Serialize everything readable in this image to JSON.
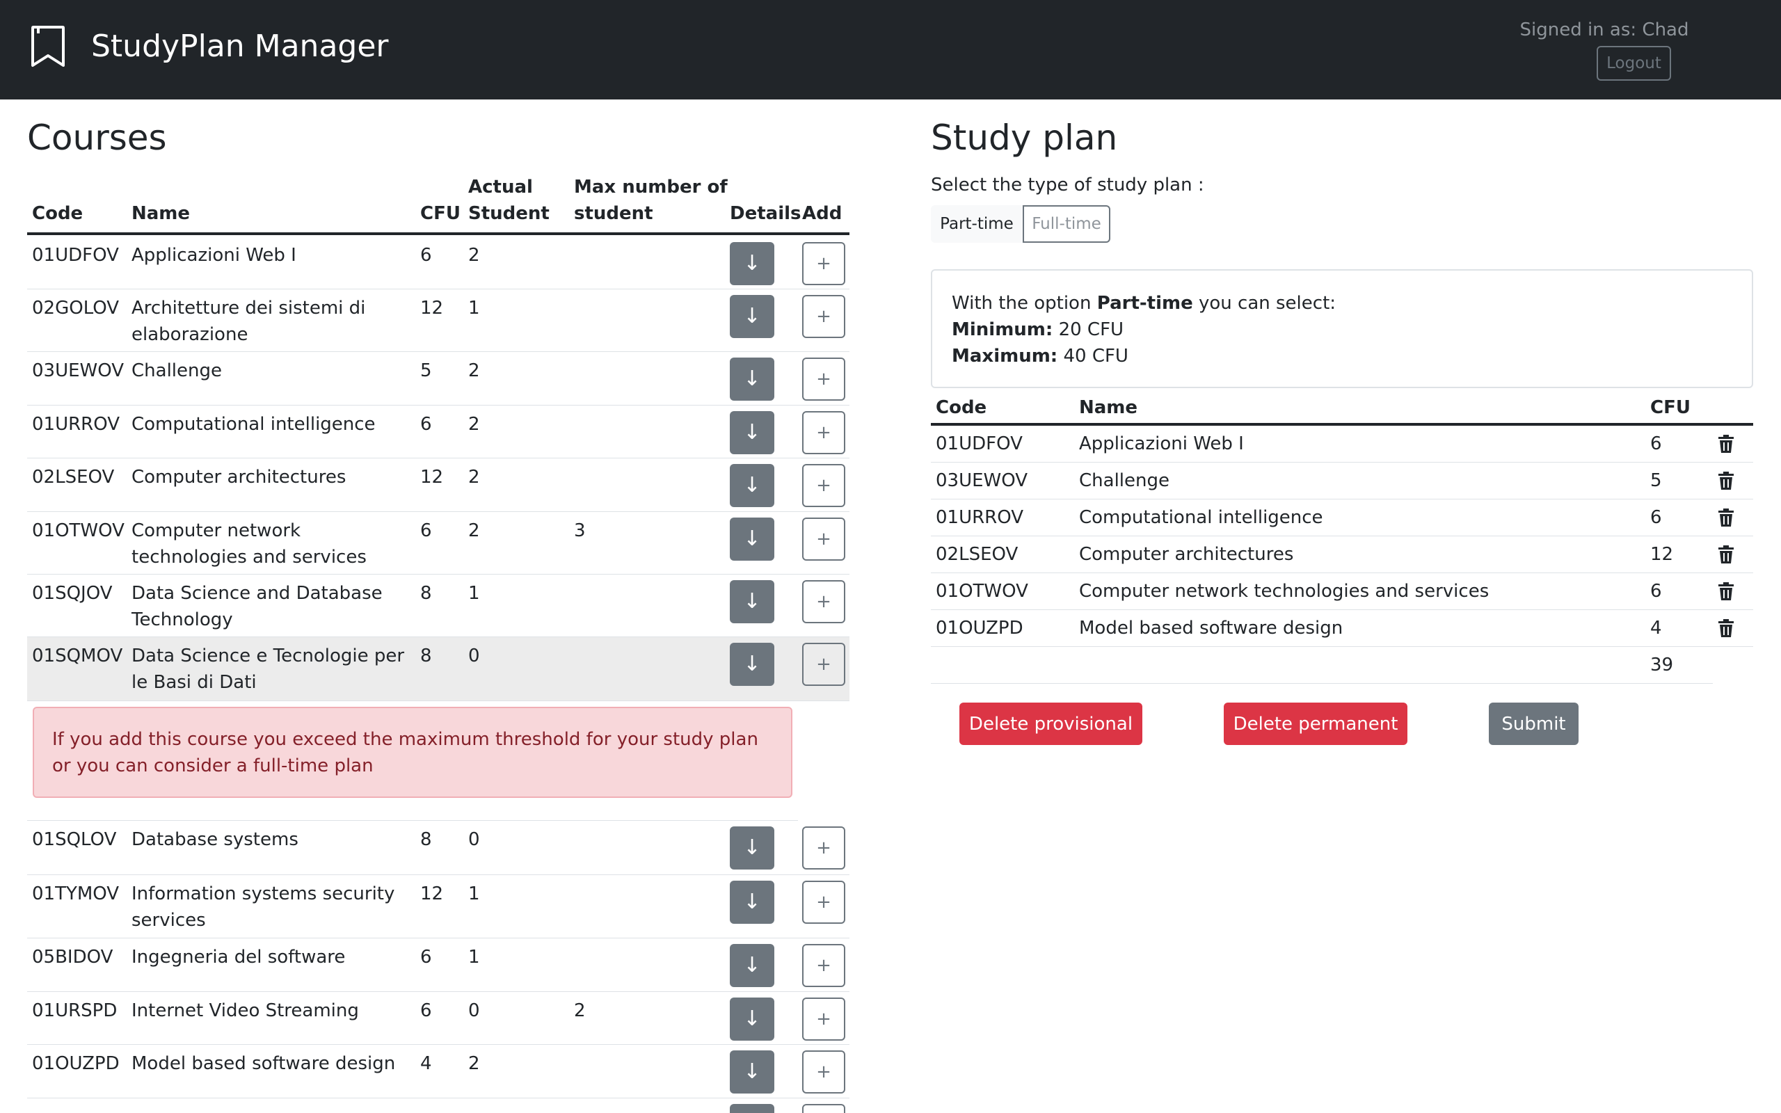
{
  "app": {
    "title": "StudyPlan Manager",
    "signed_in": "Signed in as: Chad",
    "logout_label": "Logout"
  },
  "courses": {
    "title": "Courses",
    "headers": {
      "code": "Code",
      "name": "Name",
      "cfu": "CFU",
      "actual_1": "Actual",
      "actual_2": "Student",
      "max_1": "Max number of",
      "max_2": "student",
      "details": "Details",
      "add": "Add"
    },
    "rows": [
      {
        "code": "01UDFOV",
        "name": "Applicazioni Web I",
        "cfu": "6",
        "actual": "2",
        "max": ""
      },
      {
        "code": "02GOLOV",
        "name": "Architetture dei sistemi di elaborazione",
        "cfu": "12",
        "actual": "1",
        "max": ""
      },
      {
        "code": "03UEWOV",
        "name": "Challenge",
        "cfu": "5",
        "actual": "2",
        "max": ""
      },
      {
        "code": "01URROV",
        "name": "Computational intelligence",
        "cfu": "6",
        "actual": "2",
        "max": ""
      },
      {
        "code": "02LSEOV",
        "name": "Computer architectures",
        "cfu": "12",
        "actual": "2",
        "max": ""
      },
      {
        "code": "01OTWOV",
        "name": "Computer network technologies and services",
        "cfu": "6",
        "actual": "2",
        "max": "3"
      },
      {
        "code": "01SQJOV",
        "name": "Data Science and Database Technology",
        "cfu": "8",
        "actual": "1",
        "max": ""
      },
      {
        "code": "01SQMOV",
        "name": "Data Science e Tecnologie per le Basi di Dati",
        "cfu": "8",
        "actual": "0",
        "max": ""
      },
      {
        "code": "01SQLOV",
        "name": "Database systems",
        "cfu": "8",
        "actual": "0",
        "max": ""
      },
      {
        "code": "01TYMOV",
        "name": "Information systems security services",
        "cfu": "12",
        "actual": "1",
        "max": ""
      },
      {
        "code": "05BIDOV",
        "name": "Ingegneria del software",
        "cfu": "6",
        "actual": "1",
        "max": ""
      },
      {
        "code": "01URSPD",
        "name": "Internet Video Streaming",
        "cfu": "6",
        "actual": "0",
        "max": "2"
      },
      {
        "code": "01OUZPD",
        "name": "Model based software design",
        "cfu": "4",
        "actual": "2",
        "max": ""
      }
    ],
    "alert": "If you add this course you exceed the maximum threshold for your study plan or you can consider a full-time plan"
  },
  "study_plan": {
    "title": "Study plan",
    "select_label": "Select the type of study plan :",
    "part_time": "Part-time",
    "full_time": "Full-time",
    "info_prefix": "With the option",
    "info_option": "Part-time",
    "info_suffix": "you can select:",
    "min_label": "Minimum:",
    "min_value": "20 CFU",
    "max_label": "Maximum:",
    "max_value": "40 CFU",
    "headers": {
      "code": "Code",
      "name": "Name",
      "cfu": "CFU"
    },
    "rows": [
      {
        "code": "01UDFOV",
        "name": "Applicazioni Web I",
        "cfu": "6"
      },
      {
        "code": "03UEWOV",
        "name": "Challenge",
        "cfu": "5"
      },
      {
        "code": "01URROV",
        "name": "Computational intelligence",
        "cfu": "6"
      },
      {
        "code": "02LSEOV",
        "name": "Computer architectures",
        "cfu": "12"
      },
      {
        "code": "01OTWOV",
        "name": "Computer network technologies and services",
        "cfu": "6"
      },
      {
        "code": "01OUZPD",
        "name": "Model based software design",
        "cfu": "4"
      }
    ],
    "total": "39",
    "delete_provisional": "Delete provisional",
    "delete_permanent": "Delete permanent",
    "submit": "Submit"
  },
  "icons": {
    "brand": "bookmark-icon",
    "details": "arrow-down-icon",
    "add": "plus-icon",
    "delete": "trash-icon"
  },
  "colors": {
    "navbar": "#212529",
    "danger": "#dc3545",
    "secondary": "#6c757d",
    "alert_bg": "#f8d7da",
    "alert_text": "#842029"
  }
}
